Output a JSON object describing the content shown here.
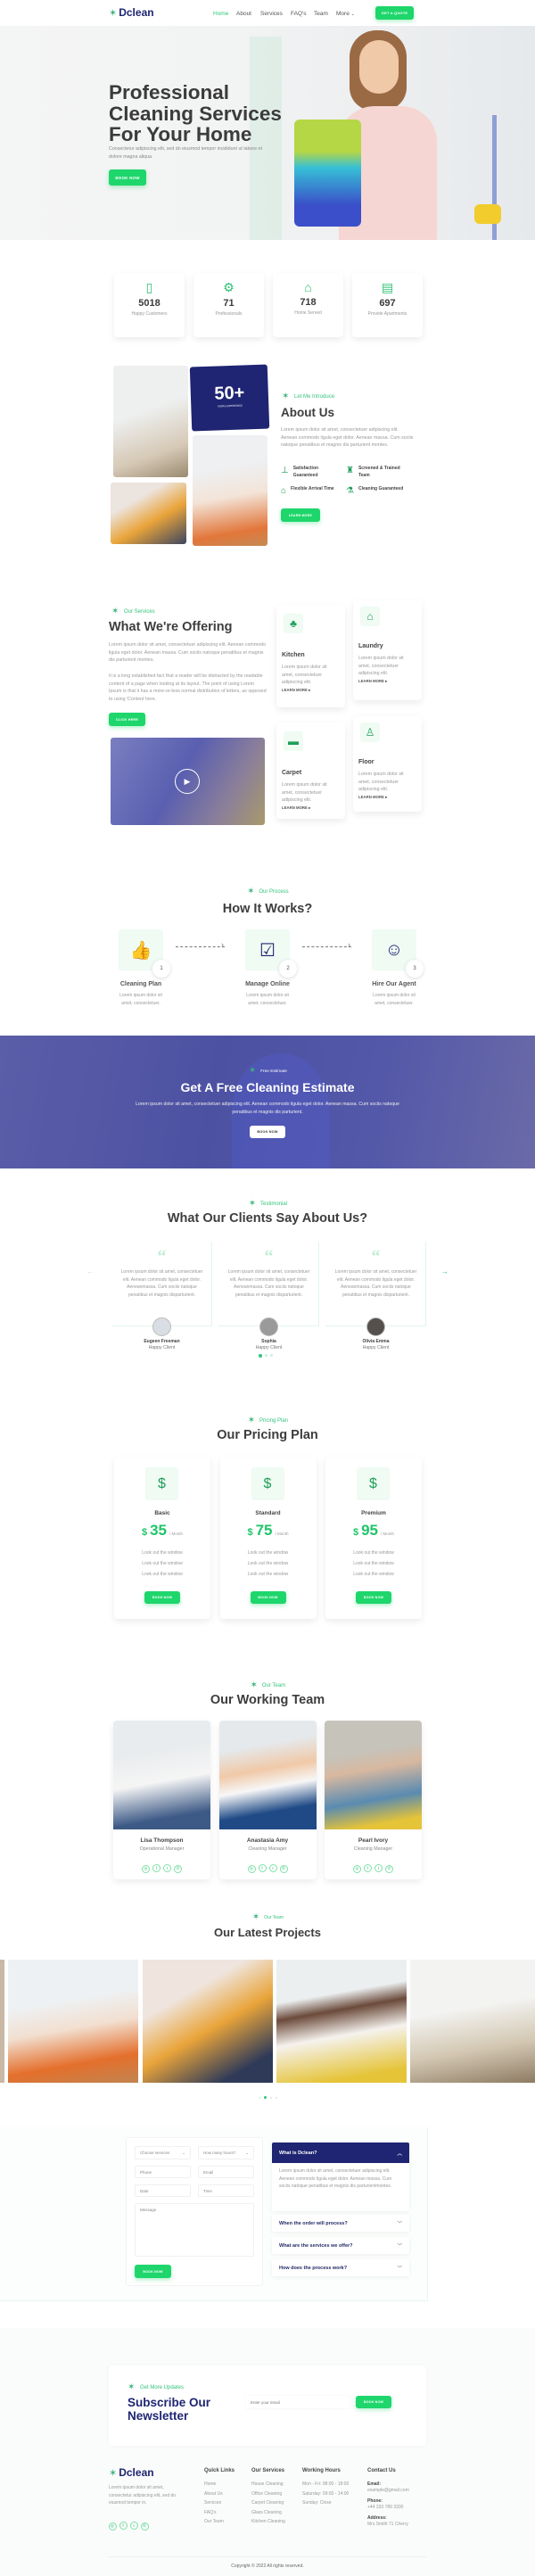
{
  "colors": {
    "accent": "#1ed66b",
    "navy": "#1f2572",
    "text": "#3d3d3d"
  },
  "nav": {
    "logo": "Dclean",
    "links": [
      "Home",
      "About",
      "Services",
      "FAQ's",
      "Team",
      "More"
    ],
    "active": "Home",
    "cta": "GET A QUOTE"
  },
  "hero": {
    "title_lines": [
      "Professional",
      "Cleaning Services",
      "For Your Home"
    ],
    "subtitle": "Consectetur adipiscing elit, sed do eiusmod tempor incididunt ut labore et dolore magna aliqua.",
    "button": "BOOK NOW"
  },
  "stats": [
    {
      "icon": "phone-rating-icon",
      "value": "5018",
      "label": "Happy Customers"
    },
    {
      "icon": "hand-gear-icon",
      "value": "71",
      "label": "Professionals"
    },
    {
      "icon": "laptop-house-icon",
      "value": "718",
      "label": "Home Served"
    },
    {
      "icon": "apartment-list-icon",
      "value": "697",
      "label": "Provide Apartments"
    }
  ],
  "about": {
    "badge_value": "50+",
    "badge_label": "YEARS EXPERIENCE",
    "tagline": "Let Me Introduce",
    "title": "About Us",
    "text": "Lorem ipsum dolor sit amet, consectetuer adipiscing elit. Aenean commodo ligula eget dolor. Aenean massa. Cum sociis natoque penatibus et magnis dis parturient montes.",
    "features": [
      {
        "icon": "squeegee-icon",
        "label": "Satisfaction Guaranteed"
      },
      {
        "icon": "spray-bottle-icon",
        "label": "Screened & Trained Team"
      },
      {
        "icon": "house-clock-icon",
        "label": "Flexible Arrival Time"
      },
      {
        "icon": "flask-icon",
        "label": "Cleaning Guaranteed"
      }
    ],
    "button": "LEARN MORE"
  },
  "services": {
    "tagline": "Our Services",
    "title": "What We're Offering",
    "text1": "Lorem ipsum dolor sit amet, consectetuer adipiscing elit. Aenean commodo ligula eget dolor. Aenean massa. Cum sociis natoque penatibus et magnis dis parturient montes.",
    "text2": "It is a long established fact that a reader will be distracted by the readable content of a page when looking at its layout. The point of using Lorem Ipsum is that it has a more-or-less normal distribution of letters, as opposed to using 'Content here.",
    "button": "CLICK HERE",
    "cards": [
      {
        "icon": "kitchen-icon",
        "title": "Kitchen",
        "text": "Lorem ipsum dolor sit amet, consectetuer adipiscing elit.",
        "link": "LEARN MORE"
      },
      {
        "icon": "laundry-icon",
        "title": "Laundry",
        "text": "Lorem ipsum dolor sit amet, consectetuer adipiscing elit.",
        "link": "LEARN MORE"
      },
      {
        "icon": "carpet-icon",
        "title": "Carpet",
        "text": "Lorem ipsum dolor sit amet, consectetuer adipiscing elit.",
        "link": "LEARN MORE"
      },
      {
        "icon": "vacuum-icon",
        "title": "Floor",
        "text": "Lorem ipsum dolor sit amet, consectetuer adipiscing elit.",
        "link": "LEARN MORE"
      }
    ]
  },
  "process": {
    "tagline": "Our Process",
    "title": "How It Works?",
    "steps": [
      {
        "num": "1",
        "icon": "phone-thumbs-up-icon",
        "title": "Cleaning Plan",
        "text": "Lorem ipsum dolor sit amet, consectetuer."
      },
      {
        "num": "2",
        "icon": "clipboard-icon",
        "title": "Manage Online",
        "text": "Lorem ipsum dolor sit amet, consectetuer."
      },
      {
        "num": "3",
        "icon": "agent-headset-icon",
        "title": "Hire Our Agent",
        "text": "Lorem ipsum dolor sit amet, consectetuer."
      }
    ]
  },
  "estimate": {
    "tagline": "Free Estimate",
    "title": "Get A Free Cleaning Estimate",
    "text": "Lorem ipsum dolor sit amet, consectetuer adipiscing elit. Aenean commodo ligula eget dolor. Aenean massa. Cum sociis natoque penatibus et magnis dis parturient.",
    "button": "BOOK NOW"
  },
  "testimonials": {
    "tagline": "Testimonial",
    "title": "What Our Clients Say About Us?",
    "items": [
      {
        "text": "Lorem ipsum dolor sit amet, consectetuer elit. Aenean commodo ligula eget dolor. Aeneanmassa. Cum sociis natoque penatibus et magnis disparturient.",
        "name": "Eugeen Freeman",
        "role": "Happy Client"
      },
      {
        "text": "Lorem ipsum dolor sit amet, consectetuer elit. Aenean commodo ligula eget dolor. Aeneanmassa. Cum sociis natoque penatibus et magnis disparturient.",
        "name": "Sophia",
        "role": "Happy Client"
      },
      {
        "text": "Lorem ipsum dolor sit amet, consectetuer elit. Aenean commodo ligula eget dolor. Aeneanmassa. Cum sociis natoque penatibus et magnis disparturient.",
        "name": "Olivia Emma",
        "role": "Happy Client"
      }
    ],
    "active_dot": 0,
    "dots": 3
  },
  "pricing": {
    "tagline": "Pricing Plan",
    "title": "Our Pricing Plan",
    "currency": "$",
    "period": "/ Month",
    "plans": [
      {
        "name": "Basic",
        "price": "35",
        "features": [
          "Look out the window",
          "Look out the window",
          "Look out the window"
        ],
        "button": "BOOK NOW"
      },
      {
        "name": "Standard",
        "price": "75",
        "features": [
          "Look out the window",
          "Look out the window",
          "Look out the window"
        ],
        "button": "BOOK NOW"
      },
      {
        "name": "Premium",
        "price": "95",
        "features": [
          "Look out the window",
          "Look out the window",
          "Look out the window"
        ],
        "button": "BOOK NOW"
      }
    ]
  },
  "team": {
    "tagline": "Our Team",
    "title": "Our Working Team",
    "members": [
      {
        "name": "Lisa Thompson",
        "role": "Operational Manager"
      },
      {
        "name": "Anastasia Amy",
        "role": "Cleaning Manager"
      },
      {
        "name": "Pearl Ivory",
        "role": "Cleaning Manager"
      }
    ],
    "socials": [
      "instagram-icon",
      "facebook-icon",
      "twitter-icon",
      "whatsapp-icon"
    ]
  },
  "projects": {
    "tagline": "Our Team",
    "title": "Our Latest Projects",
    "dots": 4,
    "active_dot": 1
  },
  "booking": {
    "fields": {
      "service": "Choose services",
      "hours": "How many hours?",
      "phone": "Phone",
      "email": "Email",
      "date": "Date",
      "time": "Time",
      "message": "Message"
    },
    "button": "BOOK NOW"
  },
  "faq": {
    "open": {
      "q": "What is Dclean?",
      "a": "Lorem ipsum dolor sit amet, consectetuer adipiscing elit. Aenean commodo ligula eget dolor. Aenean massa. Cum sociis natoque penatibus et magnis dis parturientmontes."
    },
    "items": [
      "When the order will process?",
      "What are the services we offer?",
      "How does the process work?"
    ]
  },
  "newsletter": {
    "tagline": "Get More Updates",
    "title_lines": [
      "Subscribe Our",
      "Newsletter"
    ],
    "placeholder": "Enter your email",
    "button": "BOOK NOW"
  },
  "footer": {
    "logo": "Dclean",
    "text": "Lorem ipsum dolor sit amet, consectetur adipiscing elit, sed do eiusmod tempor in.",
    "quick": {
      "title": "Quick Links",
      "links": [
        "Home",
        "About Us",
        "Services",
        "FAQ's",
        "Our Team"
      ]
    },
    "services": {
      "title": "Our Services",
      "links": [
        "House Cleaning",
        "Office Cleaning",
        "Carpet Cleaning",
        "Glass Cleaning",
        "Kitchen Cleaning"
      ]
    },
    "hours": {
      "title": "Working Hours",
      "lines": [
        "Mon - Fri: 08:00 - 18:00",
        "Saturday: 09:00 - 14:00",
        "Sunday: Close"
      ]
    },
    "contact": {
      "title": "Contact Us",
      "email_label": "Email:",
      "email": "example@gmail.com",
      "phone_label": "Phone:",
      "phone": "+44 333 789 3330",
      "address_label": "Address:",
      "address": "Mrs Smith 71 Cherry"
    },
    "copyright": "Copyright © 2022 All rights reserved."
  }
}
